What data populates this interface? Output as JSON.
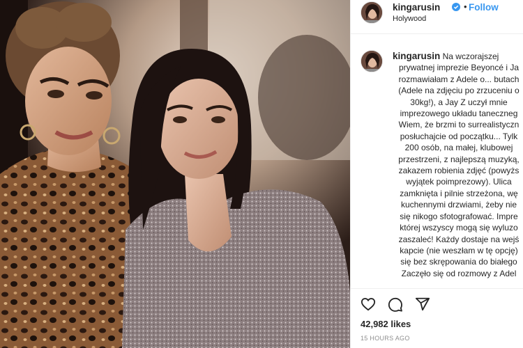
{
  "post": {
    "username": "kingarusin",
    "follow_label": "Follow",
    "location": "Holywood",
    "separator": "•",
    "caption_lines": [
      "Na wczorajszej",
      "prywatnej imprezie Beyoncé i Ja",
      "rozmawiałam z Adele o... butach",
      "(Adele na zdjęciu po zrzuceniu o",
      "30kg!), a Jay Z uczył mnie",
      "imprezowego układu taneczneg",
      "Wiem, że brzmi to surrealistyczn",
      "posłuchajcie od początku... Tylk",
      "200 osób, na małej,  klubowej",
      "przestrzeni, z najlepszą muzyką,",
      "zakazem robienia zdjęć (powyżs",
      "wyjątek poimprezowy). Ulica",
      "zamknięta i pilnie strzeżona, wę",
      "kuchennymi drzwiami, żeby nie",
      "się nikogo sfotografować. Impre",
      "której wszyscy mogą się wyluzo",
      "zaszaleć! Każdy dostaje na wejś",
      "kapcie (nie weszłam w tę opcję)",
      "się bez skrępowania do białego",
      "Zaczęło się od rozmowy z Adel"
    ],
    "likes": "42,982 likes",
    "timestamp": "15 HOURS AGO"
  },
  "icons": {
    "like": "heart-icon",
    "comment": "comment-icon",
    "share": "share-icon",
    "verified": "verified-badge-icon"
  },
  "colors": {
    "accent": "#3897f0",
    "text": "#262626",
    "muted": "#8e8e8e",
    "border": "#efefef"
  }
}
